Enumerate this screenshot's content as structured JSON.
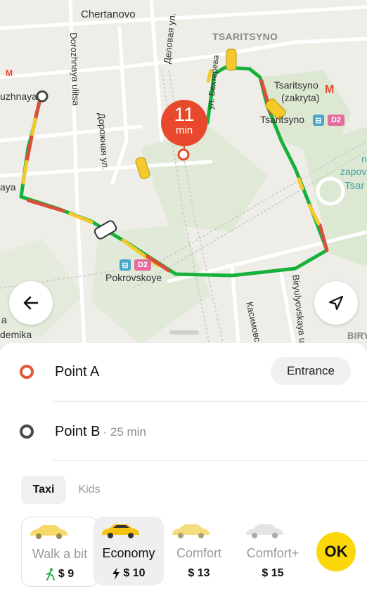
{
  "map": {
    "labels": {
      "chertanovo": "Chertanovo",
      "tsaritsyno_district": "TSARITSYNO",
      "tsaritsyno_closed_1": "Tsaritsyno",
      "tsaritsyno_closed_2": "(zakryta)",
      "tsaritsyno_station": "Tsaritsyno",
      "pokrovskoye": "Pokrovskoye",
      "uzhnaya": "uzhnaya",
      "aya": "aya",
      "demika": "demika",
      "dorozhnaya_latin": "Dorozhnaya ulitsa",
      "dorozhnaya_cyr": "Дорожная ул.",
      "delovaya": "Деловая ул.",
      "bekhtereva": "ул. Бехтерева",
      "biryulyovskaya": "Biryulyovskaya u",
      "kasimovskaya": "Касимовс",
      "zapov": "zapov",
      "tsar_right": "Tsar",
      "n_letter": "n",
      "biry": "BIRY",
      "d2_badge": "D2",
      "a_letter": "a"
    },
    "eta": {
      "value": "11",
      "unit": "min"
    },
    "colors": {
      "traffic_green": "#17b13b",
      "traffic_yellow": "#f5c92a",
      "traffic_red": "#d9503a",
      "pin": "#e8492c"
    }
  },
  "buttons": {
    "back_icon": "arrow-left-icon",
    "locate_icon": "navigation-arrow-icon"
  },
  "route": {
    "point_a": {
      "name": "Point A",
      "action": "Entrance"
    },
    "point_b": {
      "name": "Point B",
      "meta": "· 25 min"
    }
  },
  "tabs": [
    {
      "label": "Taxi",
      "active": true
    },
    {
      "label": "Kids",
      "active": false
    }
  ],
  "tariffs": [
    {
      "name": "Walk a bit",
      "price": "$ 9",
      "icon": "walking-person-icon"
    },
    {
      "name": "Economy",
      "price": "$ 10",
      "icon": "lightning-icon"
    },
    {
      "name": "Comfort",
      "price": "$ 13",
      "icon": ""
    },
    {
      "name": "Comfort+",
      "price": "$ 15",
      "icon": ""
    }
  ],
  "ok_label": "OK"
}
